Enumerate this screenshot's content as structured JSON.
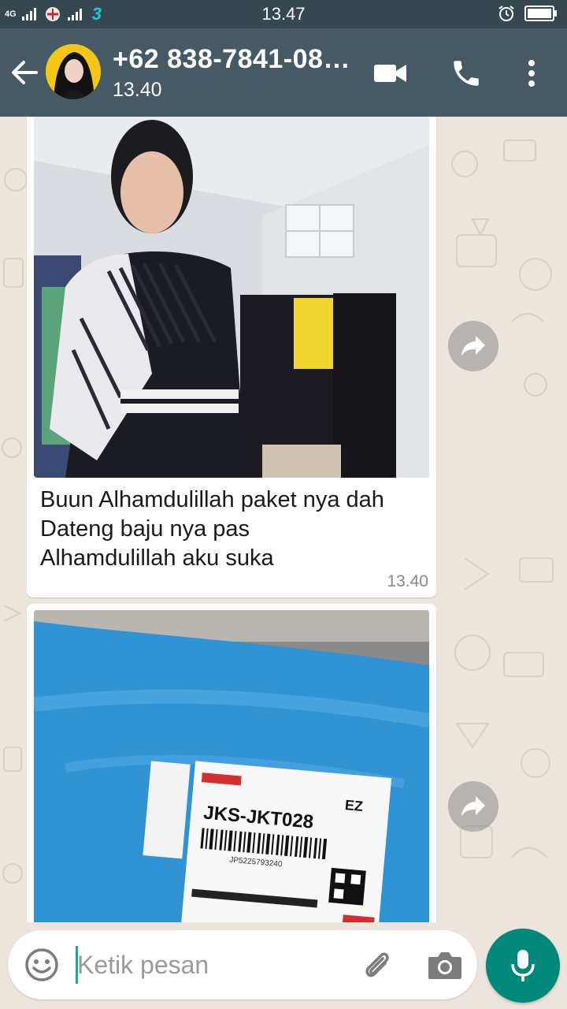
{
  "status_bar": {
    "time": "13.47",
    "network_label": "4G",
    "carrier_mark": "3"
  },
  "header": {
    "contact_name": "+62 838-7841-08…",
    "last_seen": "13.40",
    "icons": [
      "back-arrow-icon",
      "video-call-icon",
      "voice-call-icon",
      "more-vert-icon"
    ]
  },
  "messages": [
    {
      "type": "image",
      "image_subject": "selfie-photo",
      "caption_lines": [
        "Buun Alhamdulillah paket nya dah",
        "Dateng baju nya pas",
        "Alhamdulillah aku suka"
      ],
      "time": "13.40"
    },
    {
      "type": "image",
      "image_subject": "parcel-photo",
      "label_code": "JKS-JKT028",
      "label_tag": "EZ",
      "tracking_number": "JP5225793240"
    }
  ],
  "composer": {
    "placeholder": "Ketik pesan",
    "value": ""
  },
  "colors": {
    "status_bar": "#37474f",
    "app_bar": "#455a64",
    "chat_background": "#ece5dd",
    "mic_button": "#00897b",
    "cursor": "#1fa393"
  }
}
